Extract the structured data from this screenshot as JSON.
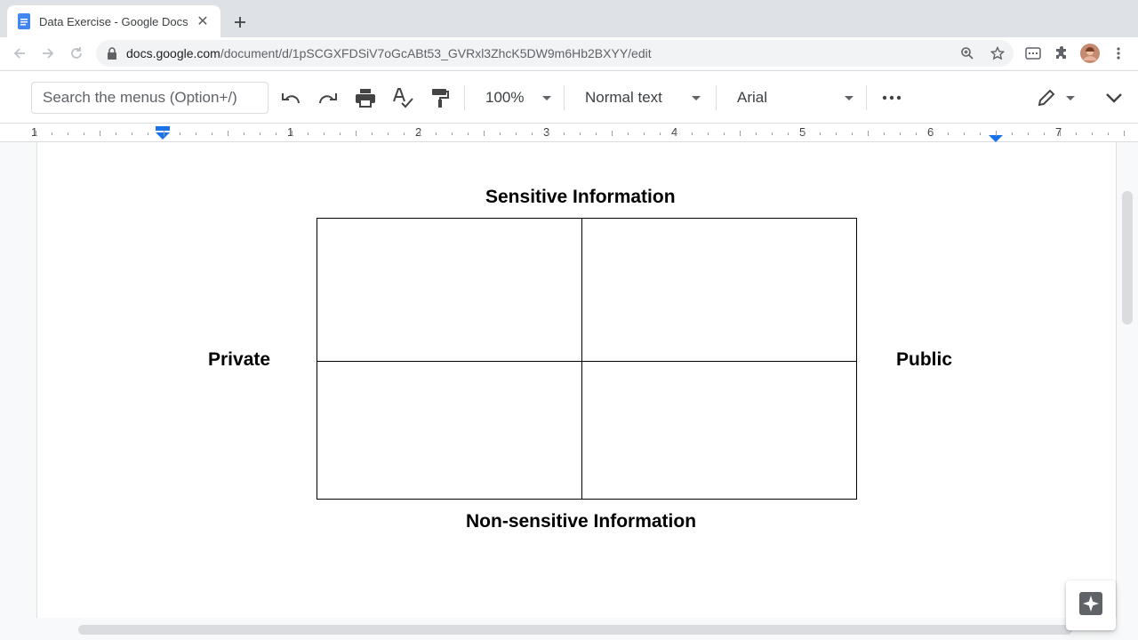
{
  "browser": {
    "tab_title": "Data Exercise - Google Docs",
    "url_host": "docs.google.com",
    "url_path": "/document/d/1pSCGXFDSiV7oGcABt53_GVRxl3ZhcK5DW9m6Hb2BXYY/edit"
  },
  "toolbar": {
    "search_placeholder": "Search the menus (Option+/)",
    "zoom": "100%",
    "style": "Normal text",
    "font": "Arial"
  },
  "ruler": {
    "labels": [
      "1",
      "1",
      "2",
      "3",
      "4",
      "5",
      "6",
      "7"
    ]
  },
  "document": {
    "top_label": "Sensitive Information",
    "bottom_label": "Non-sensitive Information",
    "left_label": "Private",
    "right_label": "Public"
  },
  "colors": {
    "docs_blue": "#4285f4",
    "ruler_marker": "#1a73e8"
  }
}
